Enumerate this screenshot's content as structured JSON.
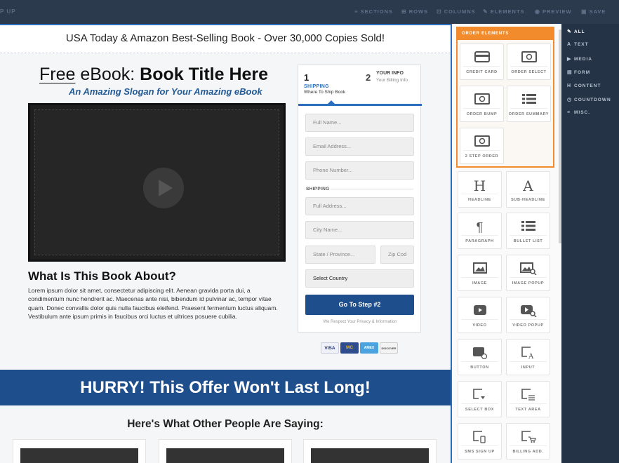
{
  "toolbar": {
    "brand": "P UP",
    "items": [
      {
        "label": "SECTIONS",
        "icon": "≡"
      },
      {
        "label": "ROWS",
        "icon": "⊞"
      },
      {
        "label": "COLUMNS",
        "icon": "⊡"
      },
      {
        "label": "ELEMENTS",
        "icon": "✎"
      },
      {
        "label": "PREVIEW",
        "icon": "◉"
      },
      {
        "label": "SAVE",
        "icon": "▣"
      }
    ]
  },
  "page": {
    "top_banner": "USA Today & Amazon Best-Selling Book - Over 30,000 Copies Sold!",
    "title_free": "Free",
    "title_mid": " eBook: ",
    "title_bold": "Book Title Here",
    "slogan": "An Amazing Slogan for Your Amazing eBook",
    "about_heading": "What Is This Book About?",
    "about_text": "Lorem ipsum dolor sit amet, consectetur adipiscing elit. Aenean gravida porta dui, a condimentum nunc hendrerit ac. Maecenas ante nisi, bibendum id pulvinar ac, tempor vitae quam. Donec convallis dolor quis nulla faucibus eleifend. Praesent fermentum luctus aliquam. Vestibulum ante ipsum primis in faucibus orci luctus et ultrices posuere cubilia.",
    "hurry": "HURRY! This Offer Won't Last Long!",
    "saying": "Here's What Other People Are Saying:"
  },
  "form": {
    "step1": {
      "num": "1",
      "label": "SHIPPING",
      "sub": "Where To Ship Book"
    },
    "step2": {
      "num": "2",
      "label": "YOUR INFO",
      "sub": "Your Billing Info"
    },
    "full_name": "Full Name...",
    "email": "Email Address...",
    "phone": "Phone Number...",
    "shipping_label": "SHIPPING",
    "address": "Full Address...",
    "city": "City Name...",
    "state": "State / Province...",
    "zip": "Zip Cod",
    "country": "Select Country",
    "button": "Go To Step #2",
    "privacy": "We Respect Your Privacy & Information",
    "cards": [
      "VISA",
      "MC",
      "AMEX",
      "DISCOVER"
    ]
  },
  "panel": {
    "order_header": "ORDER ELEMENTS",
    "order_tiles": [
      {
        "label": "CREDIT CARD",
        "icon": "credit-card-icon"
      },
      {
        "label": "ORDER SELECT",
        "icon": "money-icon"
      },
      {
        "label": "ORDER BUMP",
        "icon": "money-icon"
      },
      {
        "label": "ORDER SUMMARY",
        "icon": "list-icon"
      },
      {
        "label": "2 STEP ORDER",
        "icon": "money-icon"
      }
    ],
    "tiles": [
      {
        "label": "HEADLINE",
        "icon": "headline-icon"
      },
      {
        "label": "SUB-HEADLINE",
        "icon": "subheadline-icon"
      },
      {
        "label": "PARAGRAPH",
        "icon": "paragraph-icon"
      },
      {
        "label": "BULLET LIST",
        "icon": "bullet-list-icon"
      },
      {
        "label": "IMAGE",
        "icon": "image-icon"
      },
      {
        "label": "IMAGE POPUP",
        "icon": "image-popup-icon"
      },
      {
        "label": "VIDEO",
        "icon": "video-icon"
      },
      {
        "label": "VIDEO POPUP",
        "icon": "video-popup-icon"
      },
      {
        "label": "BUTTON",
        "icon": "button-icon"
      },
      {
        "label": "INPUT",
        "icon": "input-icon"
      },
      {
        "label": "SELECT BOX",
        "icon": "select-box-icon"
      },
      {
        "label": "TEXT AREA",
        "icon": "text-area-icon"
      },
      {
        "label": "SMS SIGN UP",
        "icon": "sms-icon"
      },
      {
        "label": "BILLING ADD.",
        "icon": "billing-icon"
      }
    ]
  },
  "categories": [
    {
      "label": "ALL",
      "icon": "✎",
      "active": true
    },
    {
      "label": "TEXT",
      "icon": "A"
    },
    {
      "label": "MEDIA",
      "icon": "▶"
    },
    {
      "label": "FORM",
      "icon": "▤"
    },
    {
      "label": "CONTENT",
      "icon": "H"
    },
    {
      "label": "COUNTDOWN",
      "icon": "◷"
    },
    {
      "label": "MISC.",
      "icon": "≡"
    }
  ],
  "colors": {
    "toolbar": "#2b3a4d",
    "accent_blue": "#1f4e8c",
    "selection_blue": "#2a6ebd",
    "order_orange": "#f18b2b"
  }
}
